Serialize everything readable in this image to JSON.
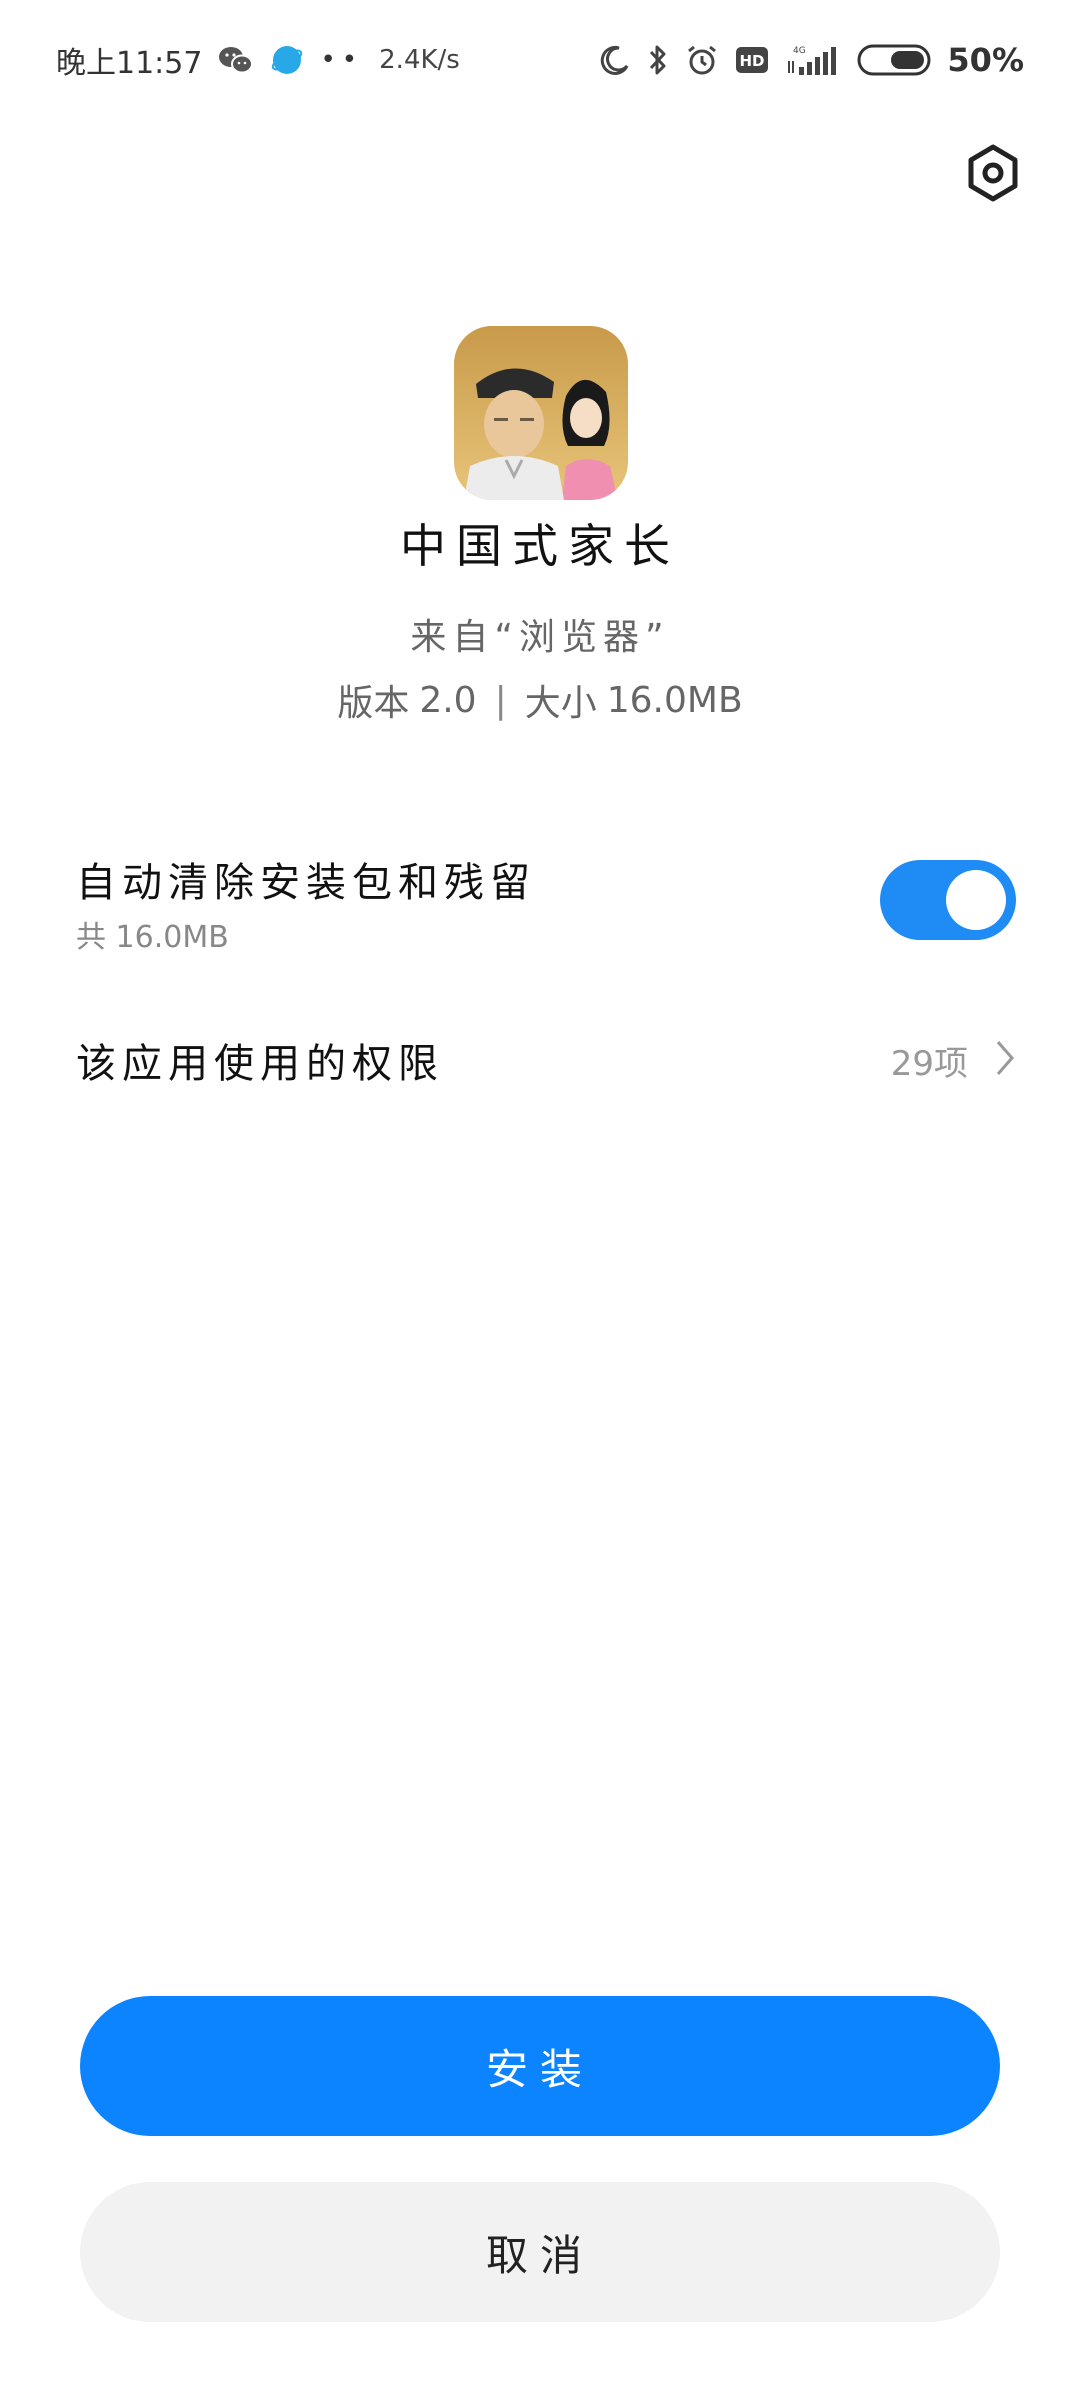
{
  "status_bar": {
    "time": "晚上11:57",
    "network_speed": "2.4K/s",
    "network_type": "4G",
    "battery": "50%",
    "icons": [
      "wechat-icon",
      "browser-icon",
      "more-dots-icon",
      "moon-icon",
      "bluetooth-icon",
      "alarm-icon",
      "hd-icon",
      "signal-icon",
      "battery-icon"
    ]
  },
  "app": {
    "name": "中国式家长",
    "source": "来自“浏览器”",
    "version_label": "版本",
    "version": "2.0",
    "size_label": "大小",
    "size": "16.0MB",
    "separator": "|"
  },
  "clean_option": {
    "title": "自动清除安装包和残留",
    "subtitle": "共 16.0MB",
    "enabled": true
  },
  "permissions": {
    "title": "该应用使用的权限",
    "count": "29项"
  },
  "actions": {
    "install_label": "安装",
    "cancel_label": "取消"
  },
  "colors": {
    "accent": "#0d84ff",
    "toggle_on": "#1f8cf5",
    "cancel_bg": "#f2f2f2"
  }
}
